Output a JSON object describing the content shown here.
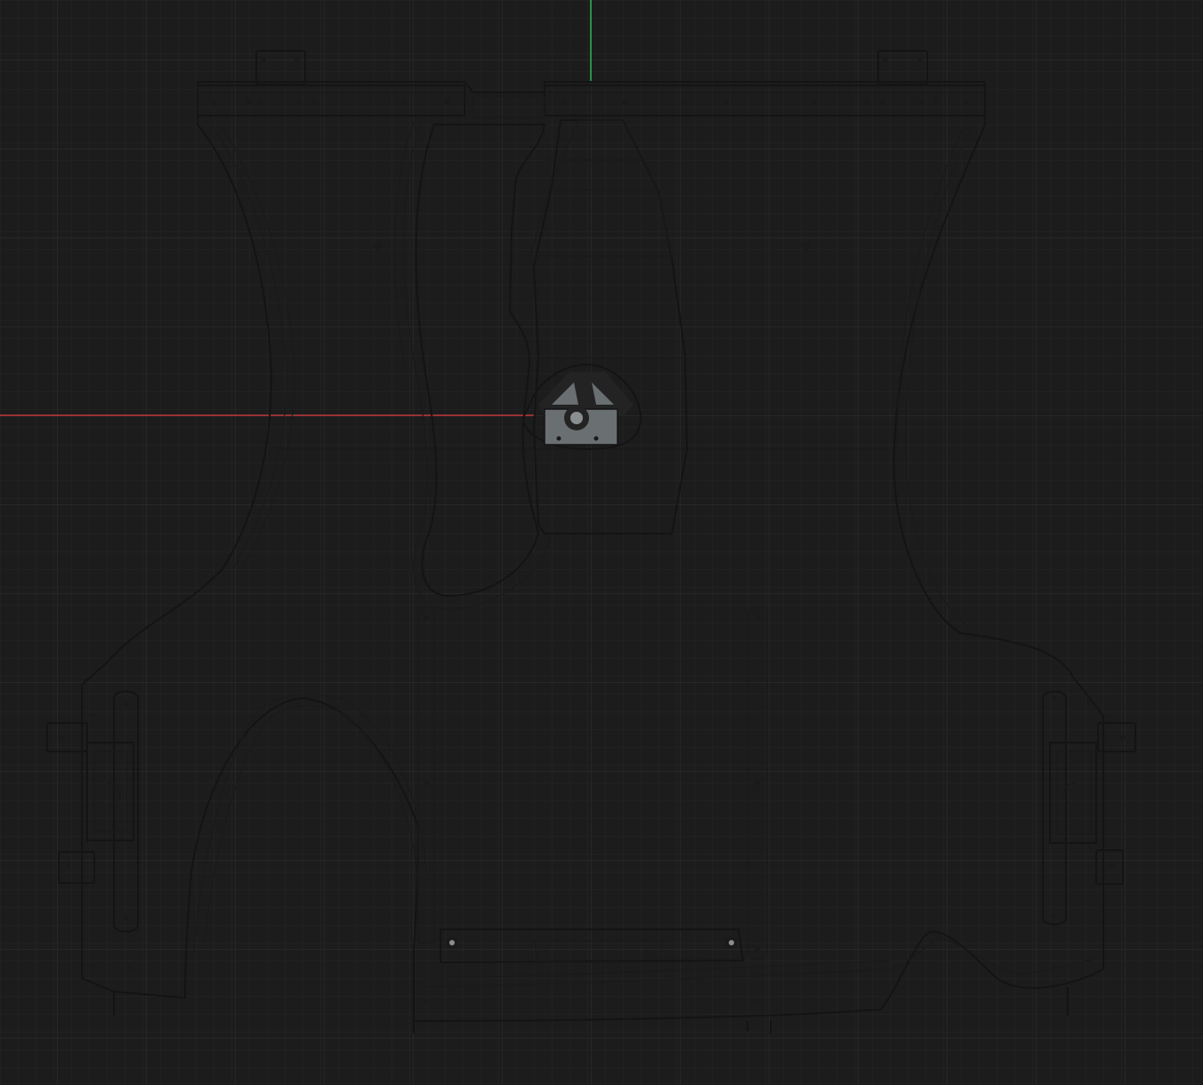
{
  "viewport": {
    "background": "#1c1c1d",
    "grid_minor_color": "#262627",
    "grid_major_color": "#2d2d2e",
    "axis_x_color": "#c0393b",
    "axis_y_color": "#3fae5a"
  },
  "model": {
    "part_fill_dark": "#6b7073",
    "part_fill_light": "#7c8083",
    "edge_color": "#141414"
  }
}
